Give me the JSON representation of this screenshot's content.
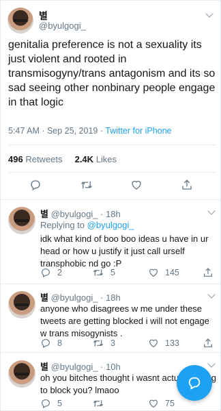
{
  "main_tweet": {
    "display_name": "별",
    "handle": "@byulgogi_",
    "text": "genitalia preference is not a sexuality its just violent and rooted in transmisogyny/trans antagonism and its so sad seeing other nonbinary people engage in that logic",
    "time": "5:47 AM · Sep 25, 2019 · ",
    "source": "Twitter for iPhone",
    "retweets_count": "496",
    "retweets_label": "Retweets",
    "likes_count": "2.4K",
    "likes_label": "Likes"
  },
  "replies": [
    {
      "display_name": "별",
      "handle": "@byulgogi_ · 18h",
      "replying_prefix": "Replying to ",
      "replying_to": "@byulgogi_",
      "text": "idk what kind of boo boo ideas u have in ur head or how u justify it just call urself transphobic nd go :P",
      "replies": "2",
      "retweets": "5",
      "likes": "145"
    },
    {
      "display_name": "별",
      "handle": "@byulgogi_ · 18h",
      "text": "anyone who disagrees w me under these tweets are getting blocked i will not engage w trans misogynists .",
      "replies": "8",
      "retweets": "3",
      "likes": "133"
    },
    {
      "display_name": "별",
      "handle": "@byulgogi_ · 10h",
      "text": "oh you bitches thought i wasnt actually going to block you? lmaoo",
      "replies": "5",
      "retweets": "",
      "likes": "75"
    }
  ],
  "colors": {
    "accent": "#1da1f2",
    "muted": "#657786",
    "text": "#14171a",
    "border": "#e6ecf0"
  }
}
